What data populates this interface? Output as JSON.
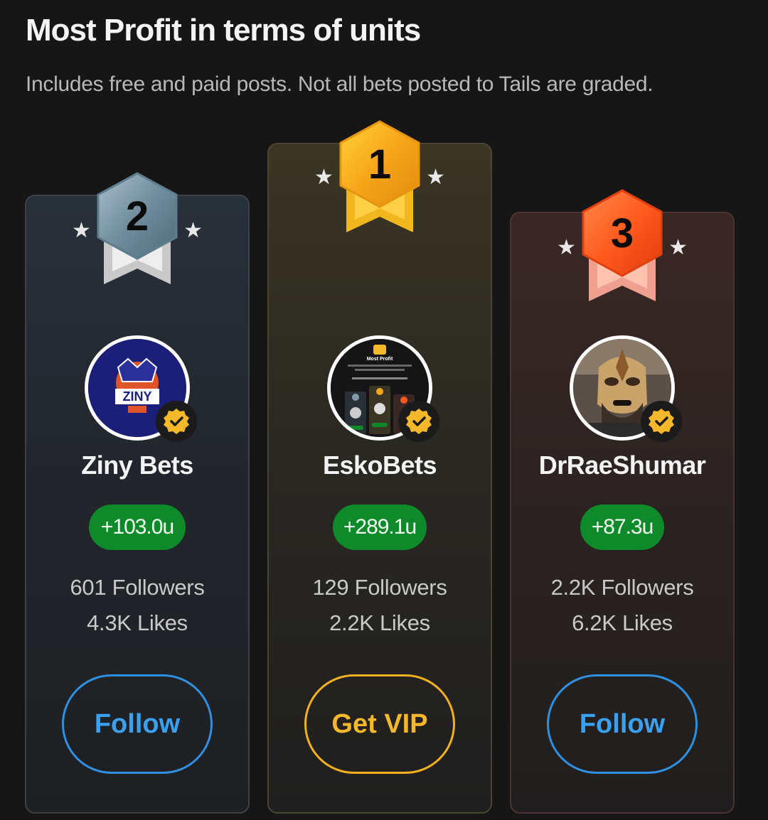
{
  "header": {
    "title": "Most Profit in terms of units",
    "subtitle": "Includes free and paid posts. Not all bets posted to Tails are graded."
  },
  "leaders": [
    {
      "rank": "2",
      "name": "Ziny Bets",
      "profit": "+103.0u",
      "followers": "601 Followers",
      "likes": "4.3K Likes",
      "action": "Follow",
      "avatar_text": "ZINY",
      "badge_color": "#7f9aa8"
    },
    {
      "rank": "1",
      "name": "EskoBets",
      "profit": "+289.1u",
      "followers": "129 Followers",
      "likes": "2.2K Likes",
      "action": "Get VIP",
      "avatar_text": "Most Profit",
      "badge_color": "#f7a51a"
    },
    {
      "rank": "3",
      "name": "DrRaeShumar",
      "profit": "+87.3u",
      "followers": "2.2K Followers",
      "likes": "6.2K Likes",
      "action": "Follow",
      "badge_color": "#ff5a1f"
    }
  ],
  "colors": {
    "profit_green": "#0f8a2b",
    "follow_blue": "#3aa0f0",
    "vip_gold": "#f5b82a",
    "verified_gold": "#f5b82a"
  }
}
